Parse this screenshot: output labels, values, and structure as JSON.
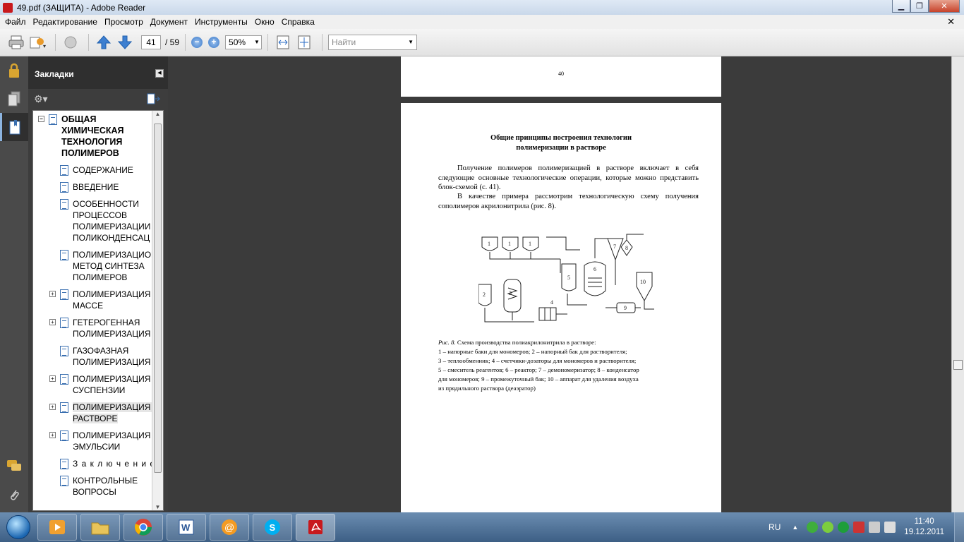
{
  "window": {
    "title": "49.pdf (ЗАЩИТА) - Adobe Reader"
  },
  "menu": {
    "items": [
      "Файл",
      "Редактирование",
      "Просмотр",
      "Документ",
      "Инструменты",
      "Окно",
      "Справка"
    ],
    "close_glyph": "✕"
  },
  "toolbar": {
    "page_current": "41",
    "page_total": "/ 59",
    "zoom": "50%",
    "find_placeholder": "Найти"
  },
  "bookmarks": {
    "title": "Закладки",
    "items": [
      {
        "label": "ОБЩАЯ ХИМИЧЕСКАЯ ТЕХНОЛОГИЯ ПОЛИМЕРОВ",
        "expander": "−",
        "level": 0
      },
      {
        "label": "СОДЕРЖАНИЕ",
        "expander": "",
        "level": 1
      },
      {
        "label": "ВВЕДЕНИЕ",
        "expander": "",
        "level": 1
      },
      {
        "label": "ОСОБЕННОСТИ ПРОЦЕССОВ ПОЛИМЕРИЗАЦИИ И ПОЛИКОНДЕНСАЦ",
        "expander": "",
        "level": 1
      },
      {
        "label": "ПОЛИМЕРИЗАЦИОННЫЙ МЕТОД СИНТЕЗА ПОЛИМЕРОВ",
        "expander": "",
        "level": 1
      },
      {
        "label": "ПОЛИМЕРИЗАЦИЯ В МАССЕ",
        "expander": "+",
        "level": 1
      },
      {
        "label": "ГЕТЕРОГЕННАЯ ПОЛИМЕРИЗАЦИЯ",
        "expander": "+",
        "level": 1
      },
      {
        "label": "ГАЗОФАЗНАЯ ПОЛИМЕРИЗАЦИЯ",
        "expander": "",
        "level": 1
      },
      {
        "label": "ПОЛИМЕРИЗАЦИЯ В СУСПЕНЗИИ",
        "expander": "+",
        "level": 1
      },
      {
        "label": "ПОЛИМЕРИЗАЦИЯ В РАСТВОРЕ",
        "expander": "+",
        "level": 1,
        "selected": true
      },
      {
        "label": "ПОЛИМЕРИЗАЦИЯ В ЭМУЛЬСИИ",
        "expander": "+",
        "level": 1
      },
      {
        "label": "З а к л ю ч е н и е",
        "expander": "",
        "level": 1
      },
      {
        "label": "КОНТРОЛЬНЫЕ ВОПРОСЫ",
        "expander": "",
        "level": 1
      }
    ]
  },
  "document": {
    "prev_page_number": "40",
    "heading_line1": "Общие принципы построения технологии",
    "heading_line2": "полимеризации в растворе",
    "para1": "Получение полимеров полимеризацией в растворе включает в себя следующие основные технологические операции, которые можно представить блок-схемой (с. 41).",
    "para2": "В качестве примера рассмотрим технологическую схему получения сополимеров акрилонитрила (рис. 8).",
    "caption_label": "Рис. 8.",
    "caption_title": "Схема производства полиакрилонитрила в растворе:",
    "caption_line1": "1 – напорные баки для мономеров; 2 – напорный бак для растворителя;",
    "caption_line2": "3 – теплообменник; 4 – счетчики-дозаторы для мономеров и растворителя;",
    "caption_line3": "5 – смеситель реагентов; 6 – реактор; 7 – демономеризатор; 8 – конденсатор",
    "caption_line4": "для мономеров; 9 – промежуточный бак; 10 – аппарат для удаления воздуха",
    "caption_line5": "из прядильного раствора (деаэратор)",
    "diagram_labels": [
      "1",
      "1",
      "1",
      "2",
      "3",
      "4",
      "5",
      "6",
      "7",
      "8",
      "9",
      "10"
    ]
  },
  "taskbar": {
    "lang": "RU",
    "time": "11:40",
    "date": "19.12.2011"
  }
}
